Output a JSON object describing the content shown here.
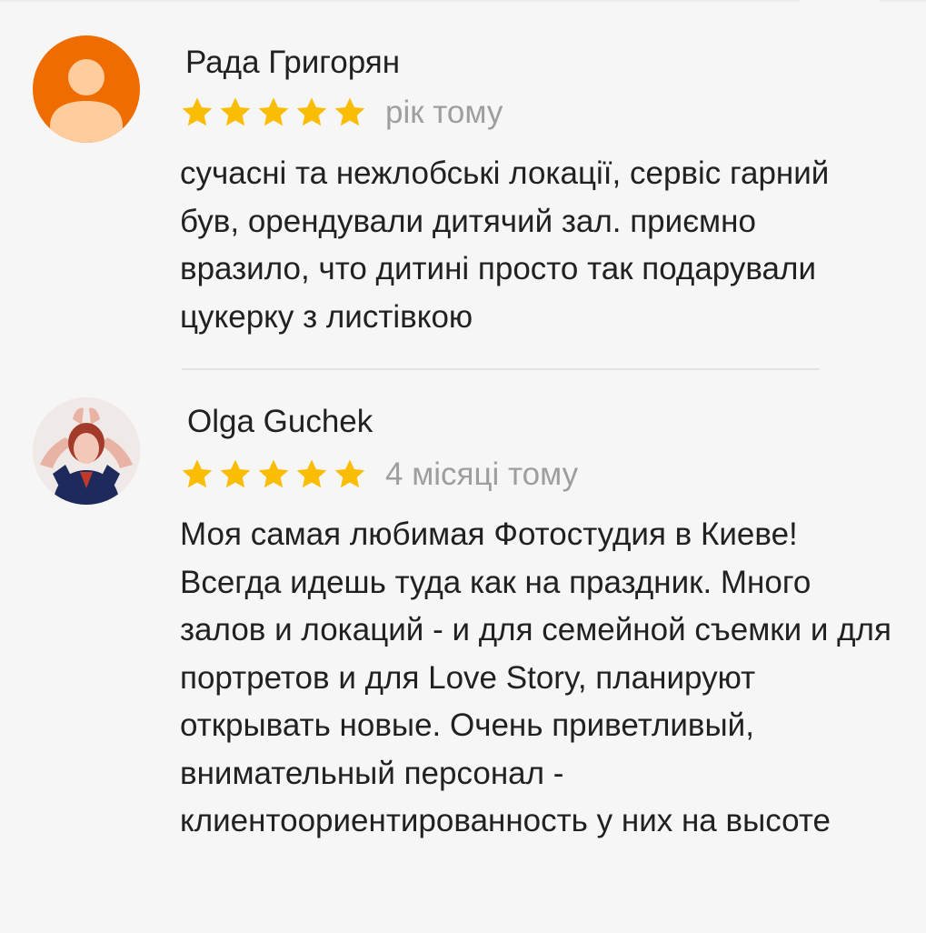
{
  "reviews": [
    {
      "author": "Рада Григорян",
      "rating": 5,
      "time": "рік тому",
      "text": "сучасні та нежлобські локації, сервіс гарний був, орендували дитячий зал. приємно вразило, что дитині просто так подарували цукерку з листівкою",
      "avatar_icon": "default-user-icon",
      "avatar_color": "#ef6c00"
    },
    {
      "author": "Olga Guchek",
      "rating": 5,
      "time": "4 місяці тому",
      "text": "Моя самая любимая Фотостудия в Киеве! Всегда идешь туда как на праздник. Много залов и локаций - и для семейной съемки и для портретов и для Love Story, планируют открывать новые. Очень приветливый, внимательный персонал - клиентоориентированность у них на высоте",
      "avatar_icon": "user-photo"
    }
  ],
  "colors": {
    "star": "#fbbc04",
    "time_text": "#9e9e9e",
    "text": "#212121",
    "background": "#f6f6f6"
  }
}
